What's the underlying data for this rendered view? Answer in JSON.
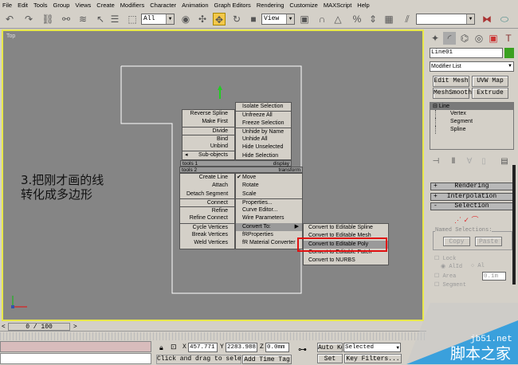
{
  "menu": [
    "File",
    "Edit",
    "Tools",
    "Group",
    "Views",
    "Create",
    "Modifiers",
    "Character",
    "Animation",
    "Graph Editors",
    "Rendering",
    "Customize",
    "MAXScript",
    "Help"
  ],
  "toolbar": {
    "selection_filter": "All",
    "ref_coord": "View",
    "named_selection": ""
  },
  "viewport": {
    "label": "Top",
    "caption_line1": "3.把刚才画的线",
    "caption_line2": "转化成多边形"
  },
  "quad_menu": {
    "tools1_items": [
      "Reverse Spline",
      "Make First",
      "Divide",
      "Bind",
      "Unbind",
      "Sub-objects"
    ],
    "display_items": [
      "Isolate Selection",
      "Unfreeze All",
      "Freeze Selection",
      "Unhide by Name",
      "Unhide All",
      "Hide Unselected",
      "Hide Selection"
    ],
    "tools1_label": "tools 1",
    "display_label": "display",
    "tools2_label": "tools 2",
    "transform_label": "transform",
    "tools2_items": [
      "Create Line",
      "Attach",
      "Detach Segment",
      "Connect",
      "Refine",
      "Refine Connect",
      "Cycle Vertices",
      "Break Vertices",
      "Weld Vertices"
    ],
    "transform_items": [
      "Move",
      "Rotate",
      "Scale",
      "Properties...",
      "Curve Editor...",
      "Wire Parameters",
      "Convert To:",
      "fRProperties",
      "fR Material Converter"
    ],
    "submenu": [
      "Convert to Editable Spline",
      "Convert to Editable Mesh",
      "Convert to Editable Poly",
      "Convert to Editable Patch",
      "Convert to NURBS"
    ],
    "highlight_color": "#e01010"
  },
  "panel": {
    "object_name": "Line01",
    "object_color": "#3aa020",
    "modifier_list": "Modifier List",
    "buttons": [
      "Edit Mesh",
      "UVW Map",
      "MeshSmooth",
      "Extrude"
    ],
    "stack": [
      "Line",
      "Vertex",
      "Segment",
      "Spline"
    ],
    "rollouts": [
      {
        "sign": "+",
        "label": "Rendering"
      },
      {
        "sign": "+",
        "label": "Interpolation"
      },
      {
        "sign": "-",
        "label": "Selection"
      }
    ],
    "named_selections": "Named Selections:",
    "copy": "Copy",
    "paste": "Paste",
    "lock": "Lock",
    "alid": "AlId",
    "al": "Al",
    "area": "Area",
    "area_value": "0.1m",
    "segment": "Segment"
  },
  "timeline": {
    "frame": "0 / 100"
  },
  "status": {
    "x_label": "X",
    "x": "457.771",
    "y_label": "Y",
    "y": "2283.988",
    "z_label": "Z",
    "z": "0.0mm",
    "prompt": "Click and drag to select",
    "add_time_tag": "Add Time Tag",
    "auto_key": "Auto Key",
    "set_key": "Set Key",
    "selected": "Selected",
    "key_filters": "Key Filters..."
  },
  "watermark": {
    "url": "jb51.net",
    "name": "脚本之家"
  }
}
